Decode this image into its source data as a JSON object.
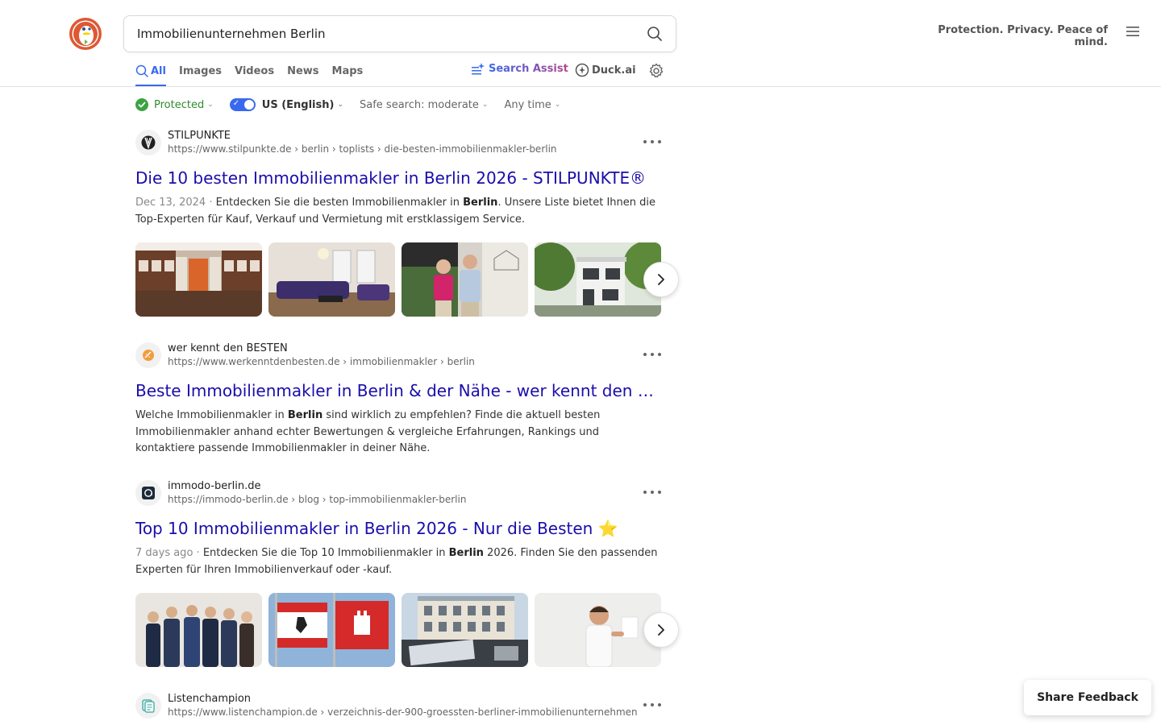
{
  "header": {
    "search_query": "Immobilienunternehmen Berlin",
    "tagline": "Protection. Privacy. Peace of mind.",
    "logo_icon": "duckduckgo-logo-icon",
    "search_icon": "search-icon",
    "menu_icon": "hamburger-menu-icon"
  },
  "tabs": [
    {
      "label": "All",
      "active": true,
      "icon": "search-icon"
    },
    {
      "label": "Images"
    },
    {
      "label": "Videos"
    },
    {
      "label": "News"
    },
    {
      "label": "Maps"
    }
  ],
  "assist": {
    "label": "Search Assist",
    "icon": "sparkle-icon"
  },
  "duckai": {
    "label": "Duck.ai",
    "icon": "duckai-chat-icon"
  },
  "settings_icon": "gear-icon",
  "filters": {
    "protected": "Protected",
    "region": "US (English)",
    "safe_search": "Safe search: moderate",
    "time": "Any time"
  },
  "results": [
    {
      "site_name": "STILPUNKTE",
      "url": "https://www.stilpunkte.de › berlin › toplists › die-besten-immobilienmakler-berlin",
      "title": "Die 10 besten Immobilienmakler in Berlin 2026 - STILPUNKTE®",
      "date": "Dec 13, 2024",
      "snippet_before": "Entdecken Sie die besten Immobilienmakler in ",
      "snippet_bold": "Berlin",
      "snippet_after": ". Unsere Liste bietet Ihnen die Top-Experten für Kauf, Verkauf und Vermietung mit erstklassigem Service."
    },
    {
      "site_name": "wer kennt den BESTEN",
      "url": "https://www.werkenntdenbesten.de › immobilienmakler › berlin",
      "title": "Beste Immobilienmakler in Berlin & der Nähe - wer kennt den BESTEN",
      "snippet_before": "Welche Immobilienmakler in ",
      "snippet_bold": "Berlin",
      "snippet_after": " sind wirklich zu empfehlen? Finde die aktuell besten Immobilienmakler anhand echter Bewertungen & vergleiche Erfahrungen, Rankings und kontaktiere passende Immobilienmakler in deiner Nähe."
    },
    {
      "site_name": "immodo-berlin.de",
      "url": "https://immodo-berlin.de › blog › top-immobilienmakler-berlin",
      "title": "Top 10 Immobilienmakler in Berlin 2026 - Nur die Besten ⭐",
      "date": "7 days ago",
      "snippet_before": "Entdecken Sie die Top 10 Immobilienmakler in ",
      "snippet_bold": "Berlin",
      "snippet_after": " 2026. Finden Sie den passenden Experten für Ihren Immobilienverkauf oder -kauf."
    },
    {
      "site_name": "Listenchampion",
      "url": "https://www.listenchampion.de › verzeichnis-der-900-groessten-berliner-immobilienunternehmen"
    }
  ],
  "feedback_label": "Share Feedback"
}
